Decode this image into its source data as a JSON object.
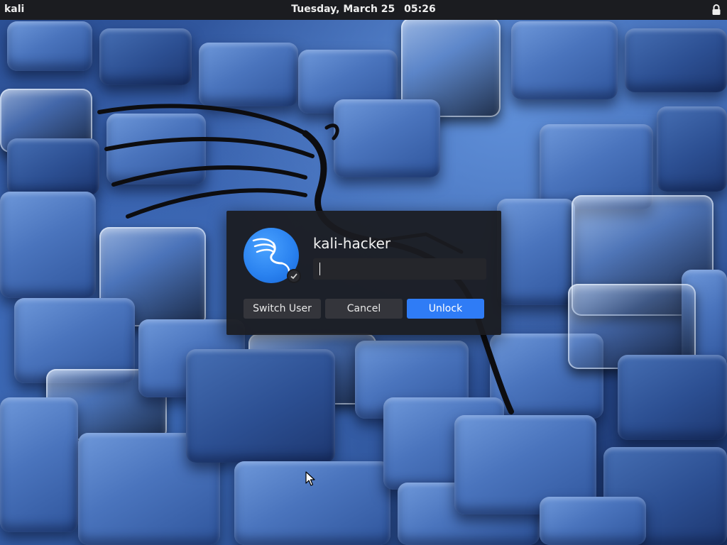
{
  "topbar": {
    "left_label": "kali",
    "date": "Tuesday, March 25",
    "time": "05:26"
  },
  "dialog": {
    "username": "kali-hacker",
    "password_value": "",
    "buttons": {
      "switch_user": "Switch User",
      "cancel": "Cancel",
      "unlock": "Unlock"
    }
  },
  "icons": {
    "lock": "lock-icon",
    "avatar": "kali-dragon-icon",
    "badge": "check-badge-icon",
    "cursor": "mouse-pointer-icon"
  },
  "colors": {
    "accent": "#2f7cf6",
    "panel": "#1b1c20",
    "avatar": "#2b83f0"
  }
}
